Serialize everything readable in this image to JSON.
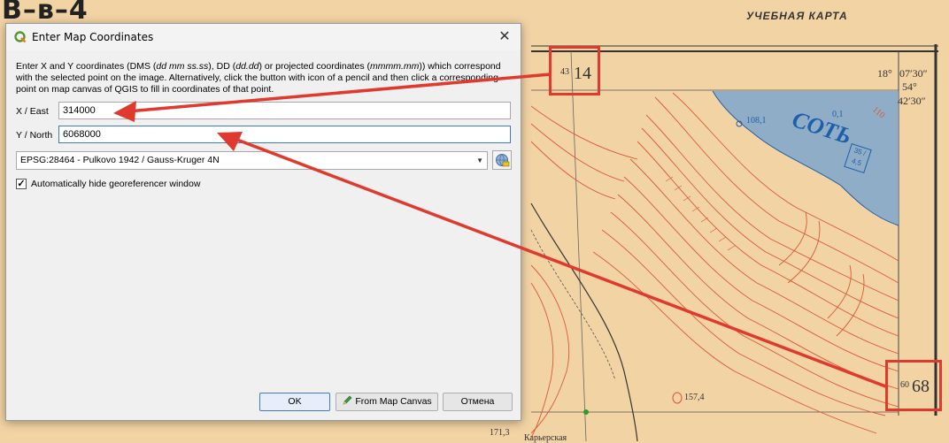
{
  "map": {
    "sheet_title": "В–в–4",
    "heading": "УЧЕБНАЯ КАРТА",
    "river_name": "СОТЬ",
    "river_depth": "0,1",
    "river_size": "35 / 4,5",
    "labels": {
      "coord_43": "43",
      "coord_14": "14",
      "coord_60": "60",
      "coord_68": "68",
      "lon_18": "18°",
      "lon_min": "07′30″",
      "lat_54": "54°",
      "lat_min": "42′30″",
      "elev_108": "108,1",
      "elev_110": "110",
      "elev_157": "157,4",
      "elev_171": "171,3",
      "place": "Карьерская"
    }
  },
  "dialog": {
    "title": "Enter Map Coordinates",
    "close_symbol": "✕",
    "description": {
      "p1": "Enter X and Y coordinates (DMS (",
      "p1_dms": "dd mm ss.ss",
      "p2": "), DD (",
      "p2_dd": "dd.dd",
      "p3": ") or projected coordinates (",
      "p3_proj": "mmmm.mm",
      "p4": ")) which correspond with the selected point on the image. Alternatively, click the button with icon of a pencil and then click a corresponding point on map canvas of QGIS to fill in coordinates of that point."
    },
    "x_label": "X / East",
    "x_value": "314000",
    "y_label": "Y / North",
    "y_value": "6068000",
    "crs": "EPSG:28464 - Pulkovo 1942 / Gauss-Kruger 4N",
    "auto_hide_label": "Automatically hide georeferencer window",
    "auto_hide_checked": "✓",
    "buttons": {
      "ok": "OK",
      "from_canvas": "From Map Canvas",
      "cancel": "Отмена"
    }
  },
  "colors": {
    "highlight": "#e03a2f",
    "contour": "#d9593a",
    "river": "#1d5fa8",
    "focus": "#3f7ac4"
  },
  "icons": [
    "qgis-icon",
    "close-icon",
    "chevron-down-icon",
    "crs-globe-icon",
    "checkmark-icon",
    "pencil-icon"
  ]
}
